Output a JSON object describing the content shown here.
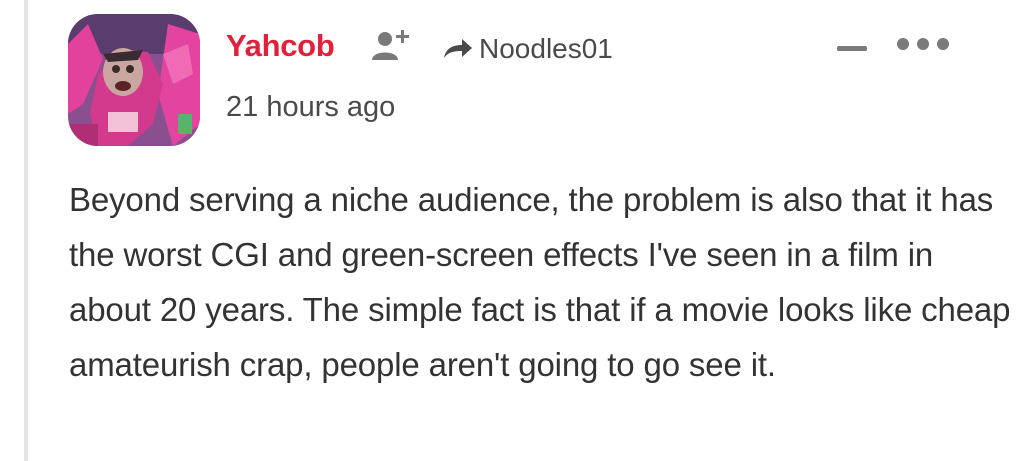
{
  "comment": {
    "author": "Yahcob",
    "reply_to": "Noodles01",
    "timestamp": "21 hours ago",
    "body": "Beyond serving a niche audience, the problem is also that it has the worst CGI and green-screen effects I've seen in a film in about 20 years. The simple fact is that if a movie looks like cheap amateurish crap, people aren't going to go see it."
  },
  "icons": {
    "follow": "follow-user-icon",
    "reply_arrow": "reply-arrow-icon",
    "collapse": "collapse-icon",
    "more": "more-options-icon"
  },
  "colors": {
    "author": "#e0213c",
    "meta_text": "#4a4a4a",
    "body_text": "#333333",
    "icon_gray": "#7a7a7a",
    "thread_line": "#e6e6ea"
  }
}
